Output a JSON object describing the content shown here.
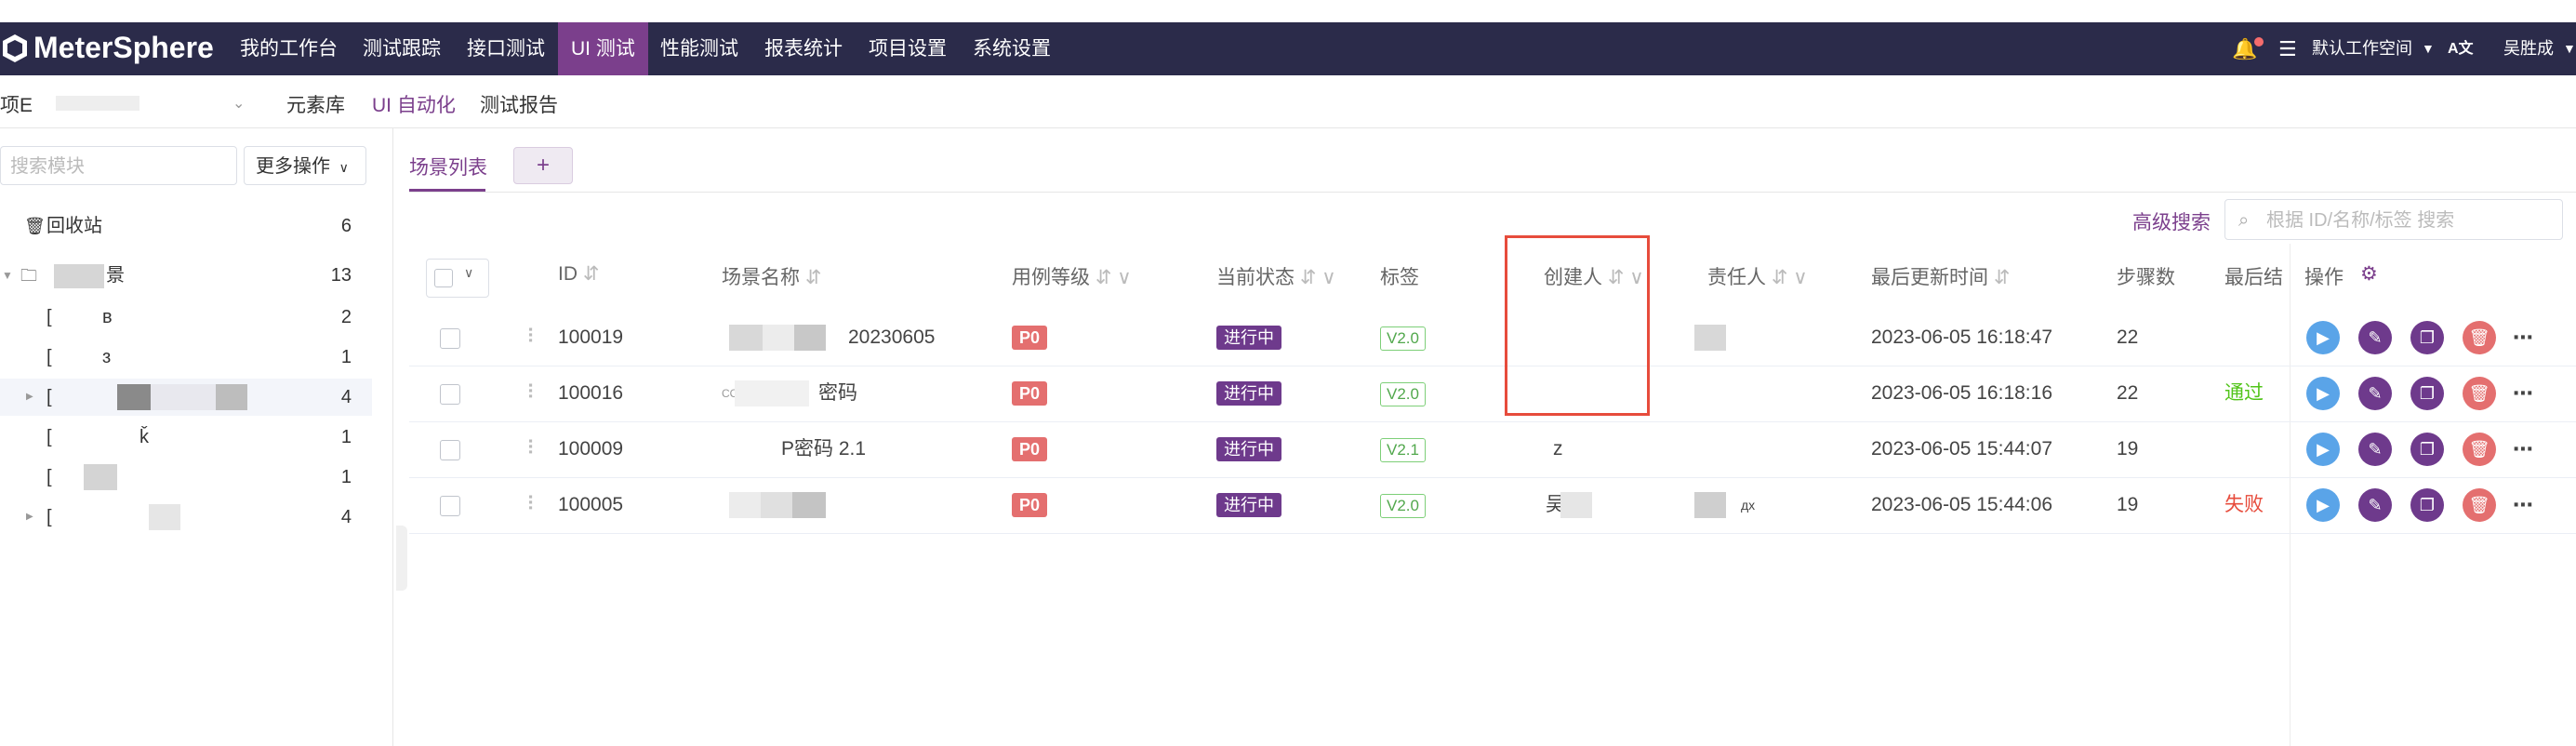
{
  "topnav": {
    "logo": "MeterSphere",
    "items": [
      {
        "label": "我的工作台"
      },
      {
        "label": "测试跟踪"
      },
      {
        "label": "接口测试"
      },
      {
        "label": "UI 测试"
      },
      {
        "label": "性能测试"
      },
      {
        "label": "报表统计"
      },
      {
        "label": "项目设置"
      },
      {
        "label": "系统设置"
      }
    ],
    "workspace": "默认工作空间",
    "user": "吴胜成",
    "accent": "#7b3f8c",
    "bg": "#2b2b4a"
  },
  "subnav": {
    "project_label": "项E",
    "items": [
      {
        "label": "元素库"
      },
      {
        "label": "UI 自动化"
      },
      {
        "label": "测试报告"
      }
    ]
  },
  "sidebar": {
    "search_placeholder": "搜索模块",
    "more_ops": "更多操作",
    "recycle": {
      "label": "回收站",
      "count": "6"
    },
    "root": {
      "label": "景",
      "count": "13"
    },
    "children": [
      {
        "label": "[",
        "suffix": "ʙ",
        "count": "2"
      },
      {
        "label": "[",
        "suffix": "ɜ",
        "count": "1"
      },
      {
        "label": "[",
        "suffix": "",
        "count": "4"
      },
      {
        "label": "[",
        "suffix": "ǩ",
        "count": "1"
      },
      {
        "label": "[",
        "suffix": "",
        "count": "1"
      },
      {
        "label": "[",
        "suffix": "",
        "count": "4"
      }
    ]
  },
  "main": {
    "tab": "场景列表",
    "add": "+",
    "advanced_search": "高级搜索",
    "search_placeholder": "根据 ID/名称/标签 搜索",
    "columns": {
      "id": "ID",
      "name": "场景名称",
      "level": "用例等级",
      "status": "当前状态",
      "tag": "标签",
      "creator": "创建人",
      "owner": "责任人",
      "updated": "最后更新时间",
      "steps": "步骤数",
      "result": "最后结果",
      "ops": "操作"
    },
    "rows": [
      {
        "id": "100019",
        "name": "20230605",
        "level": "P0",
        "status": "进行中",
        "tag": "V2.0",
        "creator": "",
        "owner": "",
        "updated": "2023-06-05 16:18:47",
        "steps": "22",
        "result": ""
      },
      {
        "id": "100016",
        "name": "密码",
        "name_prefix": "COPY",
        "level": "P0",
        "status": "进行中",
        "tag": "V2.0",
        "creator": "",
        "owner": "",
        "updated": "2023-06-05 16:18:16",
        "steps": "22",
        "result": "通过"
      },
      {
        "id": "100009",
        "name": "P密码 2.1",
        "level": "P0",
        "status": "进行中",
        "tag": "V2.1",
        "creator": "z",
        "owner": "",
        "updated": "2023-06-05 15:44:07",
        "steps": "19",
        "result": ""
      },
      {
        "id": "100005",
        "name": "",
        "level": "P0",
        "status": "进行中",
        "tag": "V2.0",
        "creator": "吴",
        "owner": "дх",
        "updated": "2023-06-05 15:44:06",
        "steps": "19",
        "result": "失败"
      }
    ]
  }
}
